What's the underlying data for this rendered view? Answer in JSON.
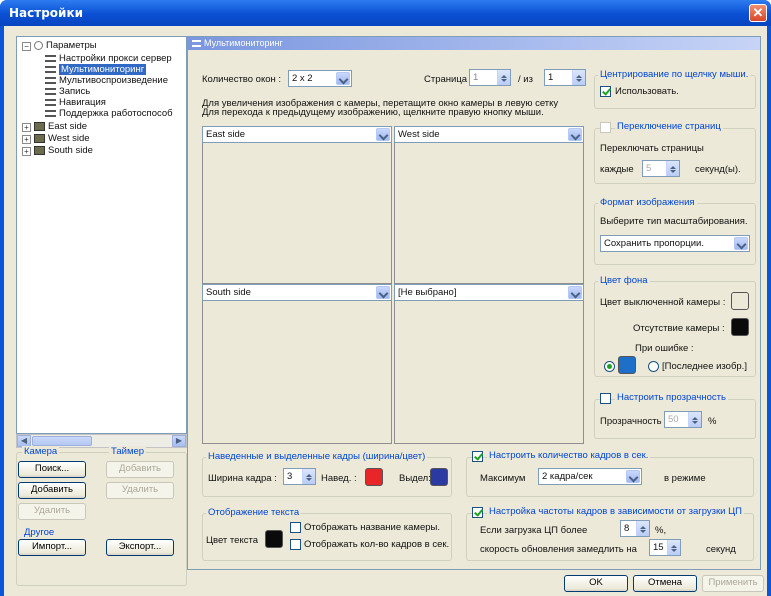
{
  "window": {
    "title": "Настройки"
  },
  "tree": {
    "root": "Параметры",
    "items": [
      "Настройки прокси сервер",
      "Мультимониторинг",
      "Мультивоспроизведение",
      "Запись",
      "Навигация",
      "Поддержка работоспособ"
    ],
    "selected_index": 1,
    "groups": [
      "East side",
      "West side",
      "South side"
    ]
  },
  "camera_group": {
    "title": "Камера",
    "search": "Поиск...",
    "add": "Добавить",
    "delete": "Удалить"
  },
  "timer_group": {
    "title": "Таймер",
    "add": "Добавить",
    "delete": "Удалить"
  },
  "other_group": {
    "title": "Другое",
    "import": "Импорт...",
    "export": "Экспорт..."
  },
  "panel": {
    "header": "Мультимониторинг",
    "windows_label": "Количество окон :",
    "windows_value": "2 x 2",
    "page_label": "Страница",
    "page_value": "1",
    "page_of_label": "/ из",
    "page_total": "1",
    "hint_line1": "Для увеличения изображения с камеры, перетащите окно камеры в левую сетку",
    "hint_line2": "Для перехода к предыдущему изображению, щелкните правую кнопку мыши.",
    "cells": [
      "East side",
      "West side",
      "South side",
      "[Не выбрано]"
    ]
  },
  "center_group": {
    "title": "Центрирование по щелчку мыши.",
    "use": "Использовать.",
    "checked": true
  },
  "page_switch": {
    "title": "Переключение страниц",
    "line1": "Переключать страницы",
    "every": "каждые",
    "value": "5",
    "unit": "секунд(ы).",
    "checked": false
  },
  "image_format": {
    "title": "Формат изображения",
    "prompt": "Выберите тип масштабирования.",
    "value": "Сохранить пропорции."
  },
  "bg_color": {
    "title": "Цвет фона",
    "off_camera": "Цвет выключенной камеры :",
    "no_camera": "Отсутствие камеры :",
    "on_error": "При ошибке :",
    "last_image": "[Последнее изобр.]",
    "colors": {
      "off": "#ece9d8",
      "none": "#0a0a0a",
      "error": "#1e6fc8"
    }
  },
  "transparency": {
    "title": "Настроить прозрачность",
    "label": "Прозрачность",
    "value": "50",
    "unit": "%",
    "checked": false
  },
  "frames": {
    "title": "Наведенные и выделенные кадры (ширина/цвет)",
    "width_label": "Ширина кадра :",
    "width_value": "3",
    "hover_label": "Навед. :",
    "select_label": "Выдел:",
    "colors": {
      "hover": "#e8262a",
      "select": "#2b3aa3"
    }
  },
  "text_display": {
    "title": "Отображение текста",
    "color_label": "Цвет текста",
    "show_name": "Отображать название камеры.",
    "show_fps": "Отображать кол-во кадров в сек.",
    "color": "#0a0a0a"
  },
  "fps_limit": {
    "title": "Настроить количество кадров в сек.",
    "max_label": "Максимум",
    "max_value": "2 кадра/сек",
    "mode": "в режиме",
    "checked": true
  },
  "cpu_fps": {
    "title": "Настройка частоты кадров в зависимости от загрузки ЦП",
    "if_label": "Если загрузка ЦП более",
    "cpu_value": "8",
    "cpu_unit": "%,",
    "slow_label": "скорость обновления замедлить на",
    "slow_value": "15",
    "slow_unit": "секунд",
    "checked": true
  },
  "footer": {
    "ok": "OK",
    "cancel": "Отмена",
    "apply": "Применить"
  }
}
